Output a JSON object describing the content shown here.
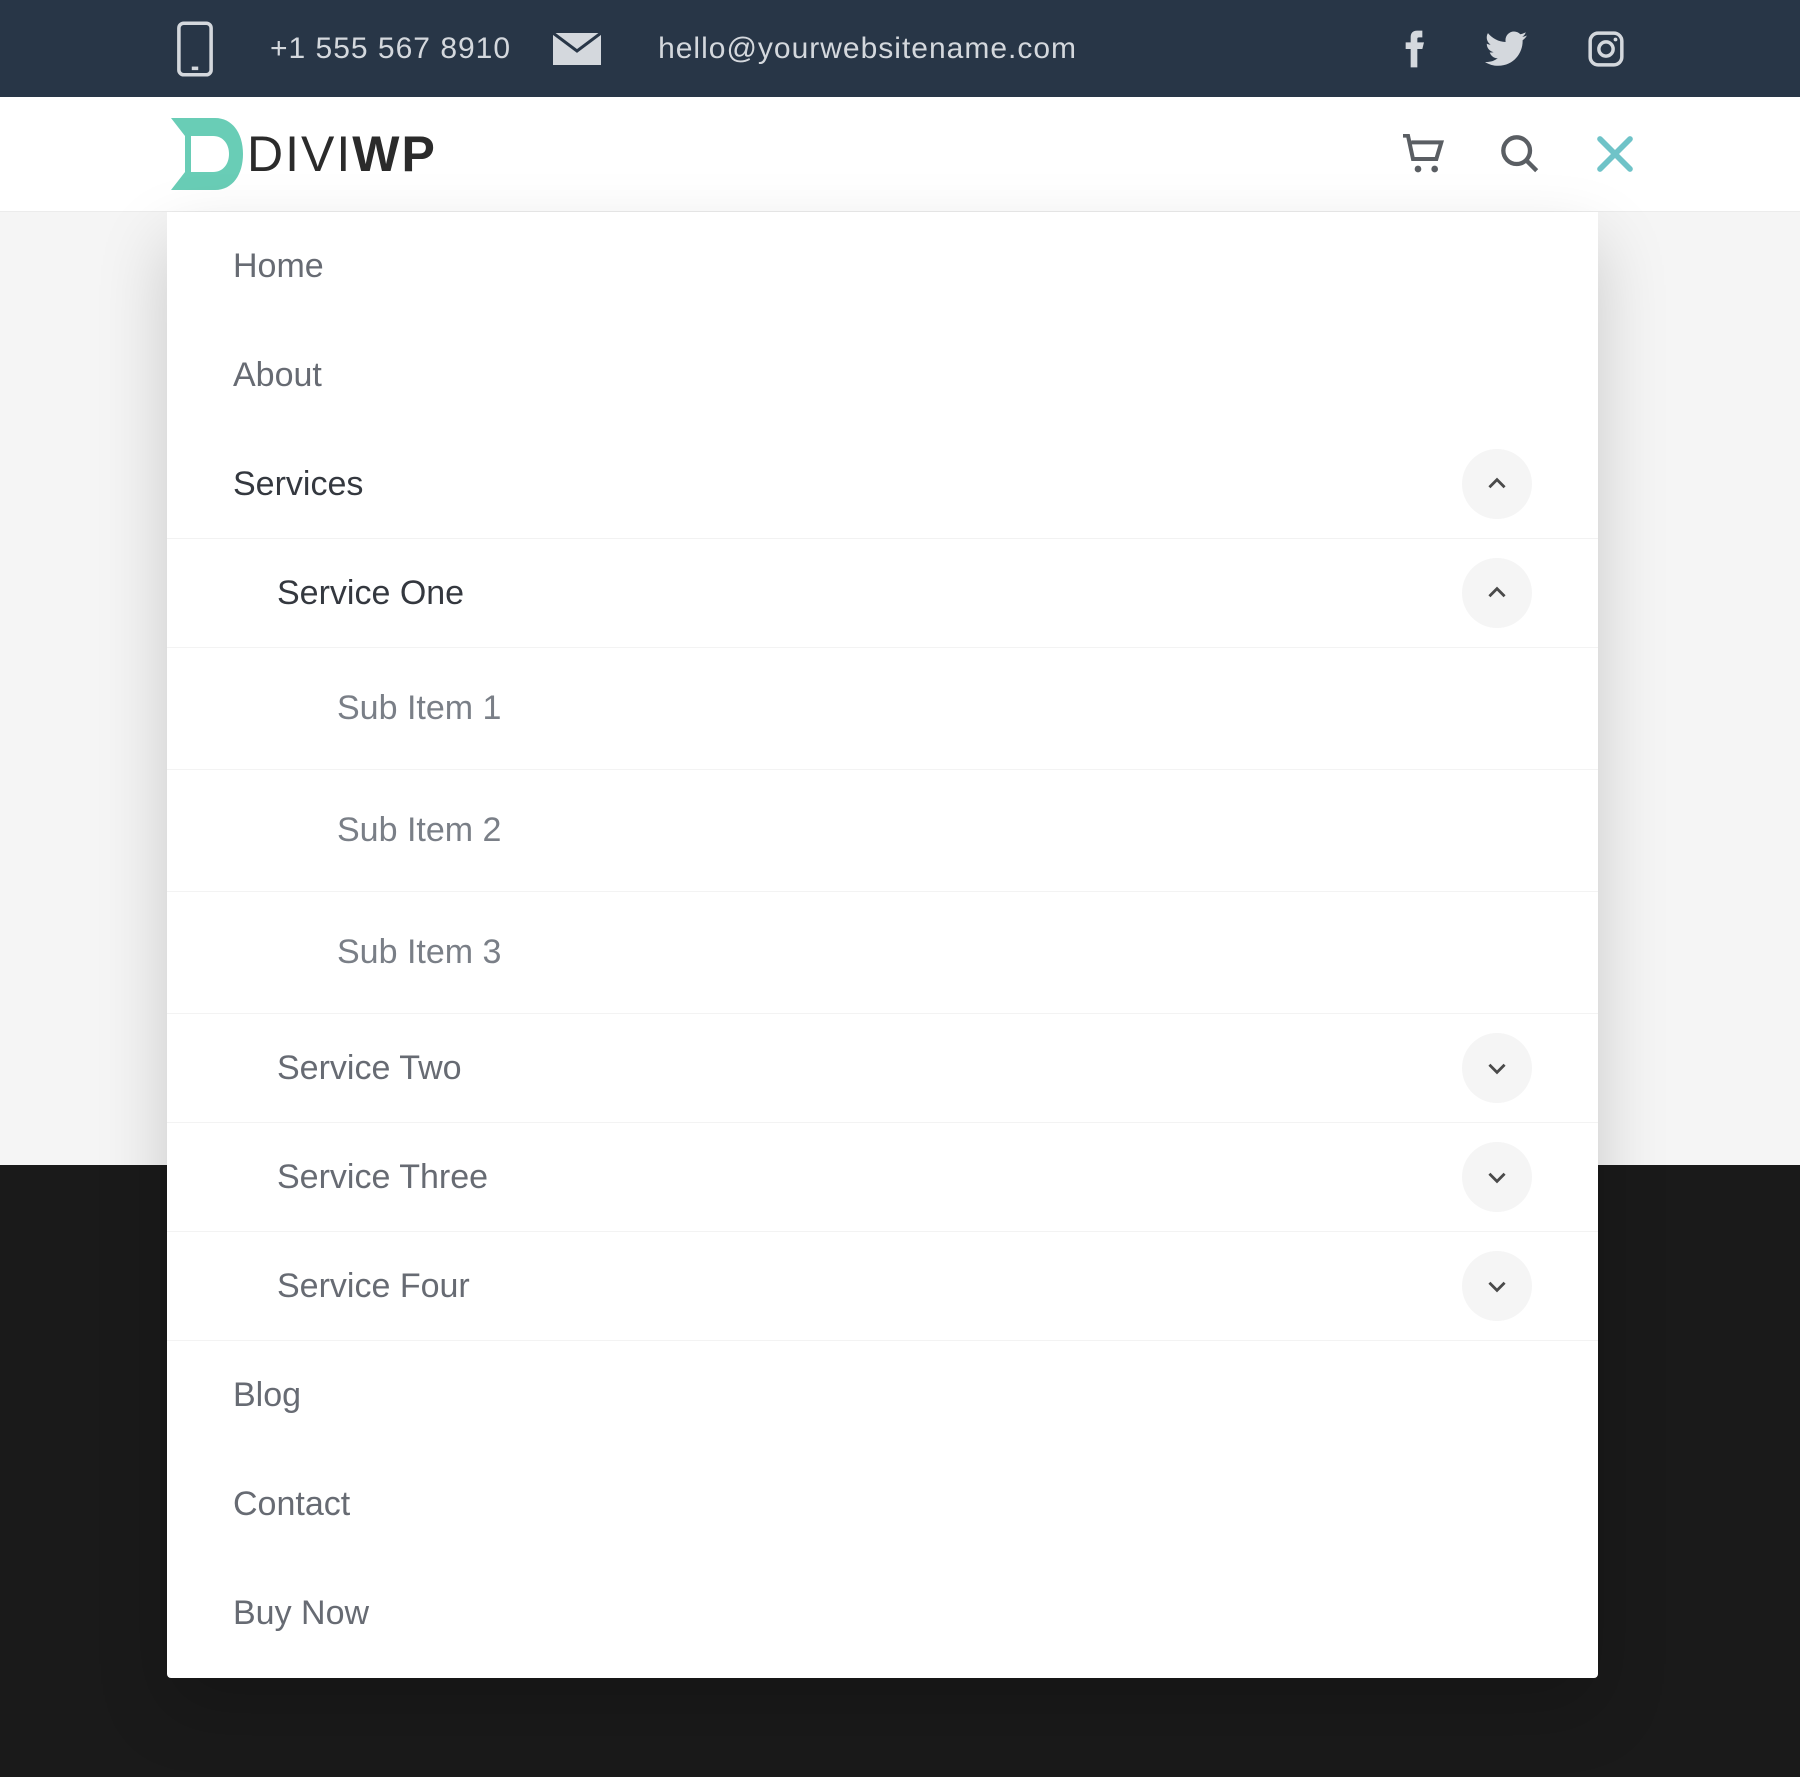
{
  "topbar": {
    "phone": "+1 555 567 8910",
    "email": "hello@yourwebsitename.com"
  },
  "logo": {
    "text_divi": "DIVI",
    "text_wp": "WP"
  },
  "menu": {
    "home": "Home",
    "about": "About",
    "services": "Services",
    "service_one": "Service One",
    "sub1": "Sub Item 1",
    "sub2": "Sub Item 2",
    "sub3": "Sub Item 3",
    "service_two": "Service Two",
    "service_three": "Service Three",
    "service_four": "Service Four",
    "blog": "Blog",
    "contact": "Contact",
    "buy_now": "Buy Now"
  }
}
